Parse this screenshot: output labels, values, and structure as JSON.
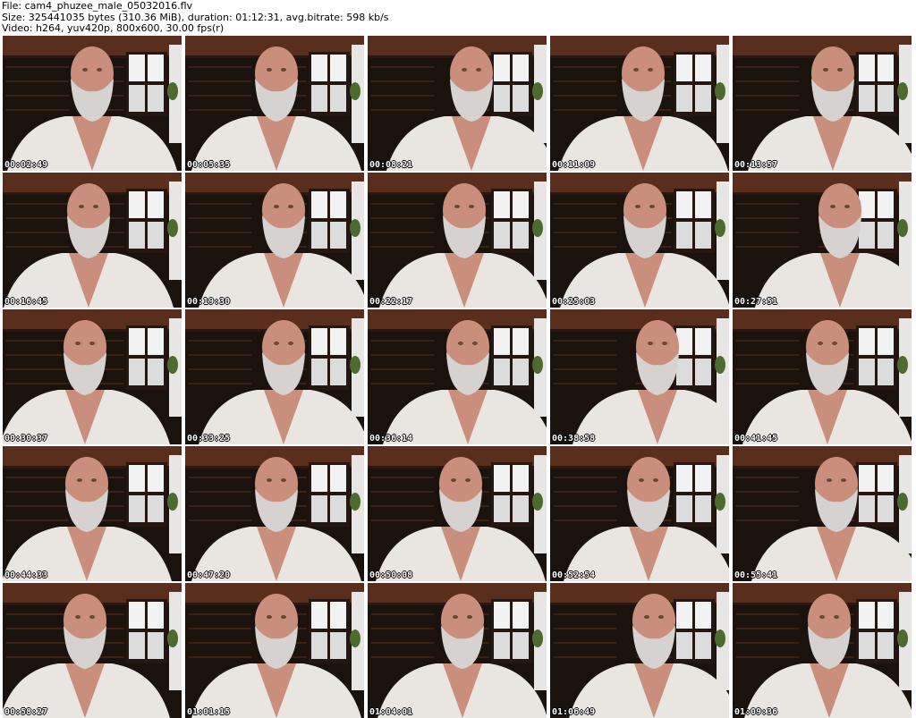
{
  "header": {
    "file_line": "File: cam4_phuzee_male_05032016.flv",
    "size_line": "Size: 325441035 bytes (310.36 MiB), duration: 01:12:31, avg.bitrate: 598 kb/s",
    "video_line": "Video: h264, yuv420p, 800x600, 30.00 fps(r)"
  },
  "colors": {
    "background": "#ffffff",
    "scene_dark": "#1a120d",
    "wood": "#5a2e1c",
    "robe": "#e9e6e2",
    "skin": "#c98f7c",
    "beard": "#d6d2cf",
    "window_light": "#f2f2f2"
  },
  "thumbnails": [
    {
      "timestamp": "00:02:49",
      "shift": 0.0
    },
    {
      "timestamp": "00:05:35",
      "shift": 0.01
    },
    {
      "timestamp": "00:08:21",
      "shift": 0.08
    },
    {
      "timestamp": "00:11:09",
      "shift": 0.02
    },
    {
      "timestamp": "00:13:57",
      "shift": 0.06
    },
    {
      "timestamp": "00:16:45",
      "shift": -0.02
    },
    {
      "timestamp": "00:19:30",
      "shift": 0.05
    },
    {
      "timestamp": "00:22:17",
      "shift": 0.04
    },
    {
      "timestamp": "00:25:03",
      "shift": 0.03
    },
    {
      "timestamp": "00:27:51",
      "shift": 0.1
    },
    {
      "timestamp": "00:30:37",
      "shift": -0.04
    },
    {
      "timestamp": "00:33:25",
      "shift": 0.05
    },
    {
      "timestamp": "00:36:14",
      "shift": 0.06
    },
    {
      "timestamp": "00:38:58",
      "shift": 0.1
    },
    {
      "timestamp": "00:41:45",
      "shift": 0.03
    },
    {
      "timestamp": "00:44:33",
      "shift": -0.03
    },
    {
      "timestamp": "00:47:20",
      "shift": 0.01
    },
    {
      "timestamp": "00:50:08",
      "shift": 0.02
    },
    {
      "timestamp": "00:52:54",
      "shift": 0.05
    },
    {
      "timestamp": "00:55:41",
      "shift": 0.08
    },
    {
      "timestamp": "00:58:27",
      "shift": -0.04
    },
    {
      "timestamp": "01:01:15",
      "shift": 0.01
    },
    {
      "timestamp": "01:04:01",
      "shift": 0.03
    },
    {
      "timestamp": "01:06:49",
      "shift": 0.08
    },
    {
      "timestamp": "01:09:36",
      "shift": 0.04
    }
  ]
}
